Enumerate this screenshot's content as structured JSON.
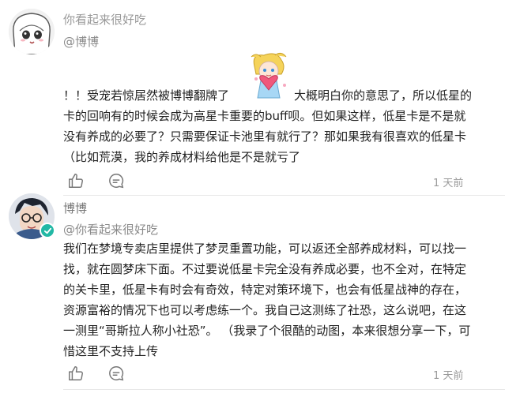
{
  "comments": [
    {
      "username": "你看起来很好吃",
      "mention": "@博博",
      "text_line1_before": "！！受宠若惊居然被博博翻牌了",
      "text_line1_after": "大概明白你的意思了，所以低星的",
      "text_line2": "卡的回响有的时候会成为高星卡重要的buff呗。但如果这样，低星卡是不是就",
      "text_line3": "没有养成的必要了？只需要保证卡池里有就行了？那如果我有很喜欢的低星卡",
      "text_line4": "（比如荒漠，我的养成材料给他是不是就亏了",
      "time": "1 天前"
    },
    {
      "username": "博博",
      "mention": "@你看起来很好吃",
      "lines": [
        "我们在梦境专卖店里提供了梦灵重置功能，可以返还全部养成材料，可以找一",
        "找，就在圆梦床下面。不过要说低星卡完全没有养成必要，也不全对，在特定",
        "的关卡里，低星卡有时会有奇效，特定对策环境下，也会有低星战神的存在，",
        "资源富裕的情况下也可以考虑练一个。我自己这测练了社恐，这么说吧，在这",
        "一测里“哥斯拉人称小社恐”。 （我录了个很酷的动图，本来很想分享一下，可",
        "惜这里不支持上传"
      ],
      "time": "1 天前"
    }
  ],
  "icons": {
    "like": "thumbs-up-icon",
    "comment": "comment-bubble-icon",
    "sticker": "heart-girl-sticker",
    "verified": "verified-badge-icon"
  },
  "colors": {
    "verified": "#22b8a5",
    "muted": "#999999"
  }
}
